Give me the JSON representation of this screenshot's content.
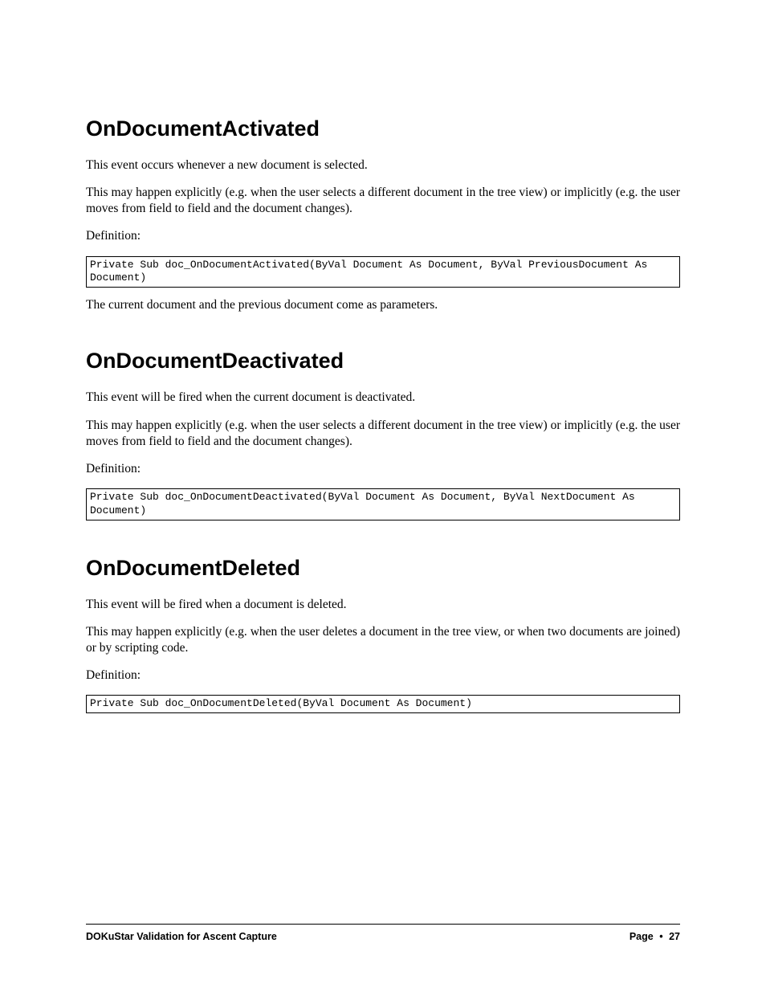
{
  "sections": [
    {
      "heading": "OnDocumentActivated",
      "paras": [
        "This event occurs whenever a new document is selected.",
        "This may happen explicitly (e.g. when the user selects a different document in the tree view) or implicitly (e.g. the user moves from field to field and the document changes).",
        "Definition:"
      ],
      "code": "Private Sub doc_OnDocumentActivated(ByVal Document As Document, ByVal PreviousDocument As Document)",
      "post_paras": [
        "The current document and the previous document come as parameters."
      ]
    },
    {
      "heading": "OnDocumentDeactivated",
      "paras": [
        "This event will be fired when the current document is deactivated.",
        "This may happen explicitly (e.g. when the user selects a different document in the tree view) or implicitly (e.g. the user moves from field to field and the document changes).",
        "Definition:"
      ],
      "code": "Private Sub doc_OnDocumentDeactivated(ByVal Document As Document, ByVal NextDocument As Document)",
      "post_paras": []
    },
    {
      "heading": "OnDocumentDeleted",
      "paras": [
        "This event will be fired when a document is deleted.",
        "This may happen explicitly (e.g. when the user deletes a document in the tree view, or when two documents are joined) or by scripting code.",
        "Definition:"
      ],
      "code": "Private Sub doc_OnDocumentDeleted(ByVal Document As Document)",
      "post_paras": []
    }
  ],
  "footer": {
    "left": "DOKuStar Validation for Ascent Capture",
    "right_label": "Page",
    "bullet": "•",
    "page_num": "27"
  }
}
